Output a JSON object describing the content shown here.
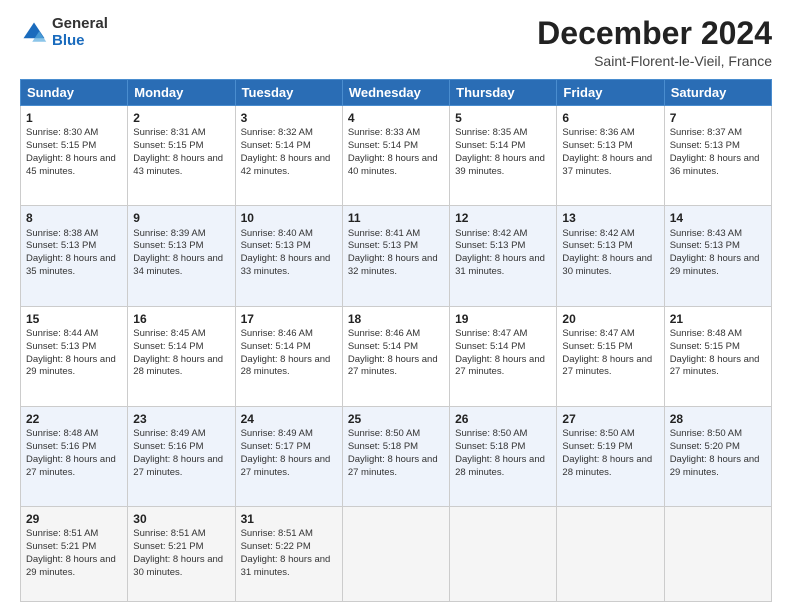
{
  "logo": {
    "general": "General",
    "blue": "Blue"
  },
  "title": "December 2024",
  "location": "Saint-Florent-le-Vieil, France",
  "days": [
    "Sunday",
    "Monday",
    "Tuesday",
    "Wednesday",
    "Thursday",
    "Friday",
    "Saturday"
  ],
  "weeks": [
    [
      {
        "day": "1",
        "sunrise": "8:30 AM",
        "sunset": "5:15 PM",
        "daylight": "8 hours and 45 minutes."
      },
      {
        "day": "2",
        "sunrise": "8:31 AM",
        "sunset": "5:15 PM",
        "daylight": "8 hours and 43 minutes."
      },
      {
        "day": "3",
        "sunrise": "8:32 AM",
        "sunset": "5:14 PM",
        "daylight": "8 hours and 42 minutes."
      },
      {
        "day": "4",
        "sunrise": "8:33 AM",
        "sunset": "5:14 PM",
        "daylight": "8 hours and 40 minutes."
      },
      {
        "day": "5",
        "sunrise": "8:35 AM",
        "sunset": "5:14 PM",
        "daylight": "8 hours and 39 minutes."
      },
      {
        "day": "6",
        "sunrise": "8:36 AM",
        "sunset": "5:13 PM",
        "daylight": "8 hours and 37 minutes."
      },
      {
        "day": "7",
        "sunrise": "8:37 AM",
        "sunset": "5:13 PM",
        "daylight": "8 hours and 36 minutes."
      }
    ],
    [
      {
        "day": "8",
        "sunrise": "8:38 AM",
        "sunset": "5:13 PM",
        "daylight": "8 hours and 35 minutes."
      },
      {
        "day": "9",
        "sunrise": "8:39 AM",
        "sunset": "5:13 PM",
        "daylight": "8 hours and 34 minutes."
      },
      {
        "day": "10",
        "sunrise": "8:40 AM",
        "sunset": "5:13 PM",
        "daylight": "8 hours and 33 minutes."
      },
      {
        "day": "11",
        "sunrise": "8:41 AM",
        "sunset": "5:13 PM",
        "daylight": "8 hours and 32 minutes."
      },
      {
        "day": "12",
        "sunrise": "8:42 AM",
        "sunset": "5:13 PM",
        "daylight": "8 hours and 31 minutes."
      },
      {
        "day": "13",
        "sunrise": "8:42 AM",
        "sunset": "5:13 PM",
        "daylight": "8 hours and 30 minutes."
      },
      {
        "day": "14",
        "sunrise": "8:43 AM",
        "sunset": "5:13 PM",
        "daylight": "8 hours and 29 minutes."
      }
    ],
    [
      {
        "day": "15",
        "sunrise": "8:44 AM",
        "sunset": "5:13 PM",
        "daylight": "8 hours and 29 minutes."
      },
      {
        "day": "16",
        "sunrise": "8:45 AM",
        "sunset": "5:14 PM",
        "daylight": "8 hours and 28 minutes."
      },
      {
        "day": "17",
        "sunrise": "8:46 AM",
        "sunset": "5:14 PM",
        "daylight": "8 hours and 28 minutes."
      },
      {
        "day": "18",
        "sunrise": "8:46 AM",
        "sunset": "5:14 PM",
        "daylight": "8 hours and 27 minutes."
      },
      {
        "day": "19",
        "sunrise": "8:47 AM",
        "sunset": "5:14 PM",
        "daylight": "8 hours and 27 minutes."
      },
      {
        "day": "20",
        "sunrise": "8:47 AM",
        "sunset": "5:15 PM",
        "daylight": "8 hours and 27 minutes."
      },
      {
        "day": "21",
        "sunrise": "8:48 AM",
        "sunset": "5:15 PM",
        "daylight": "8 hours and 27 minutes."
      }
    ],
    [
      {
        "day": "22",
        "sunrise": "8:48 AM",
        "sunset": "5:16 PM",
        "daylight": "8 hours and 27 minutes."
      },
      {
        "day": "23",
        "sunrise": "8:49 AM",
        "sunset": "5:16 PM",
        "daylight": "8 hours and 27 minutes."
      },
      {
        "day": "24",
        "sunrise": "8:49 AM",
        "sunset": "5:17 PM",
        "daylight": "8 hours and 27 minutes."
      },
      {
        "day": "25",
        "sunrise": "8:50 AM",
        "sunset": "5:18 PM",
        "daylight": "8 hours and 27 minutes."
      },
      {
        "day": "26",
        "sunrise": "8:50 AM",
        "sunset": "5:18 PM",
        "daylight": "8 hours and 28 minutes."
      },
      {
        "day": "27",
        "sunrise": "8:50 AM",
        "sunset": "5:19 PM",
        "daylight": "8 hours and 28 minutes."
      },
      {
        "day": "28",
        "sunrise": "8:50 AM",
        "sunset": "5:20 PM",
        "daylight": "8 hours and 29 minutes."
      }
    ],
    [
      {
        "day": "29",
        "sunrise": "8:51 AM",
        "sunset": "5:21 PM",
        "daylight": "8 hours and 29 minutes."
      },
      {
        "day": "30",
        "sunrise": "8:51 AM",
        "sunset": "5:21 PM",
        "daylight": "8 hours and 30 minutes."
      },
      {
        "day": "31",
        "sunrise": "8:51 AM",
        "sunset": "5:22 PM",
        "daylight": "8 hours and 31 minutes."
      },
      null,
      null,
      null,
      null
    ]
  ],
  "labels": {
    "sunrise": "Sunrise:",
    "sunset": "Sunset:",
    "daylight": "Daylight:"
  }
}
